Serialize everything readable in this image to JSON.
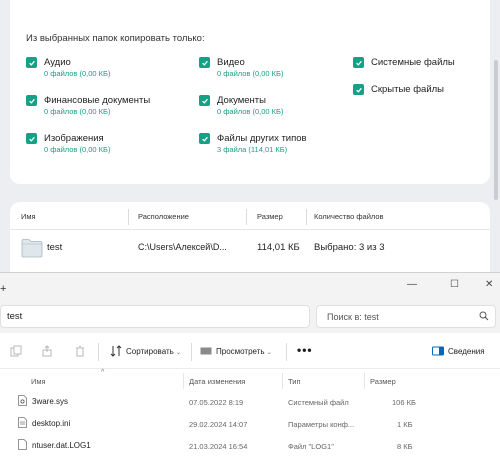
{
  "copy_options": {
    "title": "Из выбранных папок копировать только:",
    "items": [
      {
        "label": "Аудио",
        "sub": "0 файлов (0,00 КБ)",
        "checked": true
      },
      {
        "label": "Финансовые документы",
        "sub": "0 файлов (0,00 КБ)",
        "checked": true
      },
      {
        "label": "Изображения",
        "sub": "0 файлов (0,00 КБ)",
        "checked": true
      },
      {
        "label": "Видео",
        "sub": "0 файлов (0,00 КБ)",
        "checked": true
      },
      {
        "label": "Документы",
        "sub": "0 файлов (0,00 КБ)",
        "checked": true
      },
      {
        "label": "Файлы других типов",
        "sub": "3 файла (114,01 КБ)",
        "checked": true
      },
      {
        "label": "Системные файлы",
        "sub": "",
        "checked": true
      },
      {
        "label": "Скрытые файлы",
        "sub": "",
        "checked": true
      }
    ]
  },
  "folders_table": {
    "headers": [
      "Имя",
      "Расположение",
      "Размер",
      "Количество файлов"
    ],
    "row": {
      "name": "test",
      "location": "C:\\Users\\Алексей\\D...",
      "size": "114,01 КБ",
      "count": "Выбрано: 3 из 3"
    }
  },
  "explorer": {
    "new_tab": "+",
    "controls": {
      "minimize": "—",
      "maximize": "☐",
      "close": "✕"
    },
    "address": "test",
    "search_placeholder": "Поиск в: test",
    "toolbar": {
      "sort": "Сортировать",
      "view": "Просмотреть",
      "more": "•••",
      "details": "Сведения"
    },
    "columns": [
      "Имя",
      "Дата изменения",
      "Тип",
      "Размер"
    ],
    "sort_indicator": "^",
    "files": [
      {
        "name": "3ware.sys",
        "date": "07.05.2022 8:19",
        "type": "Системный файл",
        "size": "106 КБ"
      },
      {
        "name": "desktop.ini",
        "date": "29.02.2024 14:07",
        "type": "Параметры конф...",
        "size": "1 КБ"
      },
      {
        "name": "ntuser.dat.LOG1",
        "date": "21.03.2024 16:54",
        "type": "Файл \"LOG1\"",
        "size": "8 КБ"
      }
    ]
  },
  "colors": {
    "accent": "#16a085",
    "details_icon": "#0067c0"
  }
}
